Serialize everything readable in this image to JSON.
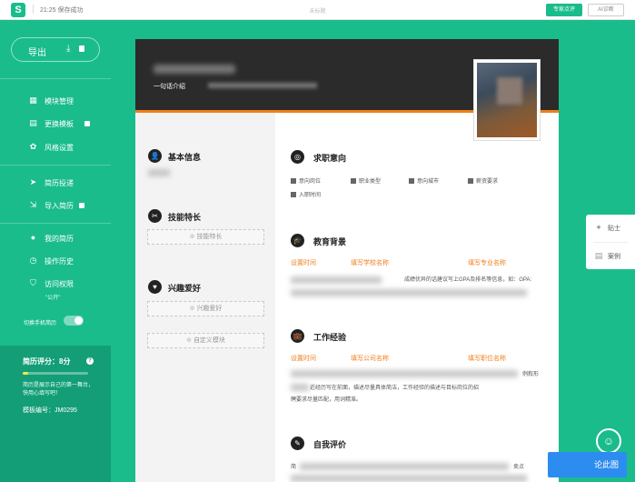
{
  "topbar": {
    "logo": "S",
    "save_status": "21:25 保存成功",
    "doc_title": "未标题",
    "expert_button": "专家点评",
    "ai_button": "AI诊断"
  },
  "sidebar": {
    "export_label": "导出",
    "items": [
      {
        "label": "模块管理",
        "icon": "grid-icon"
      },
      {
        "label": "更换模板",
        "icon": "template-icon"
      },
      {
        "label": "风格设置",
        "icon": "palette-icon"
      },
      {
        "label": "简历投递",
        "icon": "send-icon"
      },
      {
        "label": "导入简历",
        "icon": "import-icon"
      },
      {
        "label": "我的简历",
        "icon": "user-icon"
      },
      {
        "label": "操作历史",
        "icon": "history-icon"
      },
      {
        "label": "访问权限",
        "icon": "shield-icon"
      }
    ],
    "permission_value": "\"公开\"",
    "mobile_toggle_label": "切换手机简历",
    "score_label": "简历评分：8分",
    "score_fraction": 0.08,
    "score_tip": "简历是展示自己的第一舞台，快用心填写吧！",
    "template_no": "模板编号：JM0295"
  },
  "resume": {
    "intro_label": "一句话介绍",
    "left_sections": {
      "basic_info": "基本信息",
      "skills": "技能特长",
      "skills_add": "技能特长",
      "hobbies": "兴趣爱好",
      "hobbies_add": "兴趣爱好",
      "custom_add": "自定义模块"
    },
    "intent": {
      "title": "求职意向",
      "fields": [
        "意向岗位",
        "职业类型",
        "意向城市",
        "薪资要求",
        "入职时间"
      ]
    },
    "education": {
      "title": "教育背景",
      "time": "设置时间",
      "school": "填写学校名称",
      "major": "填写专业名称",
      "desc": "成绩优异的话建议写上GPA及排名等信息，如：GPA:"
    },
    "work": {
      "title": "工作经验",
      "time": "设置时间",
      "company": "填写公司名称",
      "position": "填写职位名称",
      "desc_line1": "例叙形",
      "desc_line2": "近经历写在前面，描述尽量具体简洁，工作经验的描述与目标岗位的招",
      "desc_line3": "聘要求尽量匹配，用词精准。"
    },
    "self_eval": {
      "title": "自我评价",
      "desc_line1": "简",
      "desc_line2": "卖点"
    }
  },
  "right_panel": {
    "tips": "贴士",
    "cases": "案例"
  },
  "bottom_button": "论此图"
}
